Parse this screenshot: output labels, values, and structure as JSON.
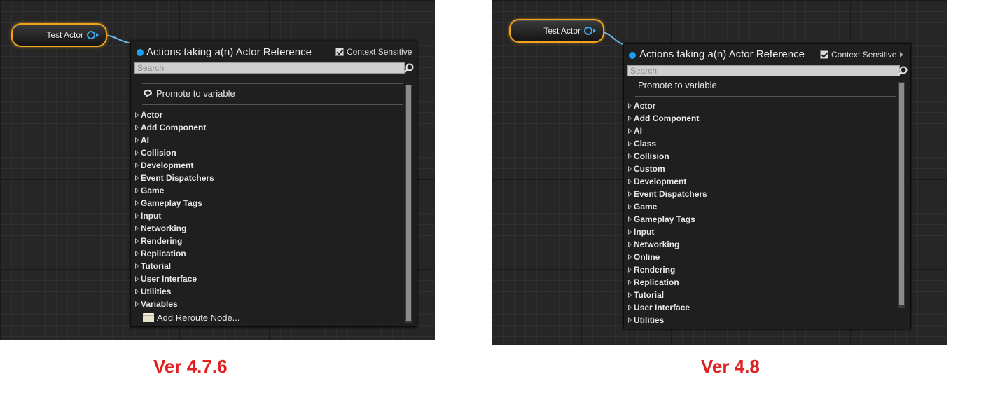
{
  "left": {
    "node_label": "Test Actor",
    "menu_title": "Actions taking a(n) Actor Reference",
    "context_label": "Context Sensitive",
    "search_placeholder": "Search",
    "promote_label": "Promote to variable",
    "categories": [
      "Actor",
      "Add Component",
      "AI",
      "Collision",
      "Development",
      "Event Dispatchers",
      "Game",
      "Gameplay Tags",
      "Input",
      "Networking",
      "Rendering",
      "Replication",
      "Tutorial",
      "User Interface",
      "Utilities",
      "Variables"
    ],
    "reroute_label": "Add Reroute Node...",
    "version_label": "Ver 4.7.6"
  },
  "right": {
    "node_label": "Test Actor",
    "menu_title": "Actions taking a(n) Actor Reference",
    "context_label": "Context Sensitive",
    "search_placeholder": "Search",
    "promote_label": "Promote to variable",
    "categories": [
      "Actor",
      "Add Component",
      "AI",
      "Class",
      "Collision",
      "Custom",
      "Development",
      "Event Dispatchers",
      "Game",
      "Gameplay Tags",
      "Input",
      "Networking",
      "Online",
      "Rendering",
      "Replication",
      "Tutorial",
      "User Interface",
      "Utilities"
    ],
    "version_label": "Ver 4.8"
  },
  "colors": {
    "node_border": "#f0a31a",
    "pin": "#3fa8f0",
    "header_dot": "#1aa0f0",
    "version_text": "#e02020"
  },
  "icons": {
    "search": "magnifier-icon",
    "promote": "speech-bubble-icon",
    "reroute": "reroute-node-icon",
    "category": "triangle-expand-icon"
  }
}
